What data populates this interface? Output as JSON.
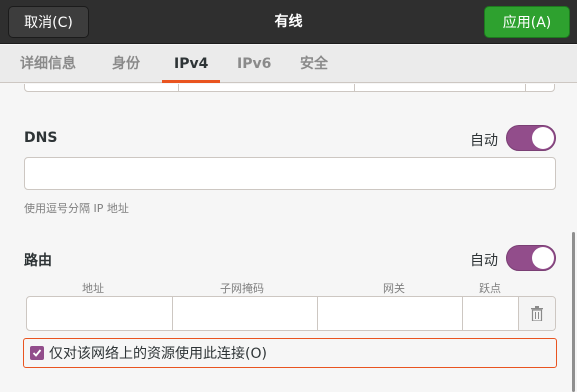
{
  "header": {
    "cancel_label": "取消(C)",
    "title": "有线",
    "apply_label": "应用(A)"
  },
  "tabs": [
    {
      "label": "详细信息",
      "active": false
    },
    {
      "label": "身份",
      "active": false
    },
    {
      "label": "IPv4",
      "active": true
    },
    {
      "label": "IPv6",
      "active": false
    },
    {
      "label": "安全",
      "active": false
    }
  ],
  "dns": {
    "title": "DNS",
    "auto_label": "自动",
    "auto_enabled": true,
    "value": "",
    "hint": "使用逗号分隔 IP 地址"
  },
  "routes": {
    "title": "路由",
    "auto_label": "自动",
    "auto_enabled": true,
    "columns": [
      "地址",
      "子网掩码",
      "网关",
      "跃点"
    ],
    "row": {
      "address": "",
      "netmask": "",
      "gateway": "",
      "metric": ""
    },
    "only_local_label": "仅对该网络上的资源使用此连接(O)",
    "only_local_checked": true
  },
  "colors": {
    "accent": "#e95420",
    "switch_on": "#924d8b",
    "apply": "#2ea12f"
  }
}
